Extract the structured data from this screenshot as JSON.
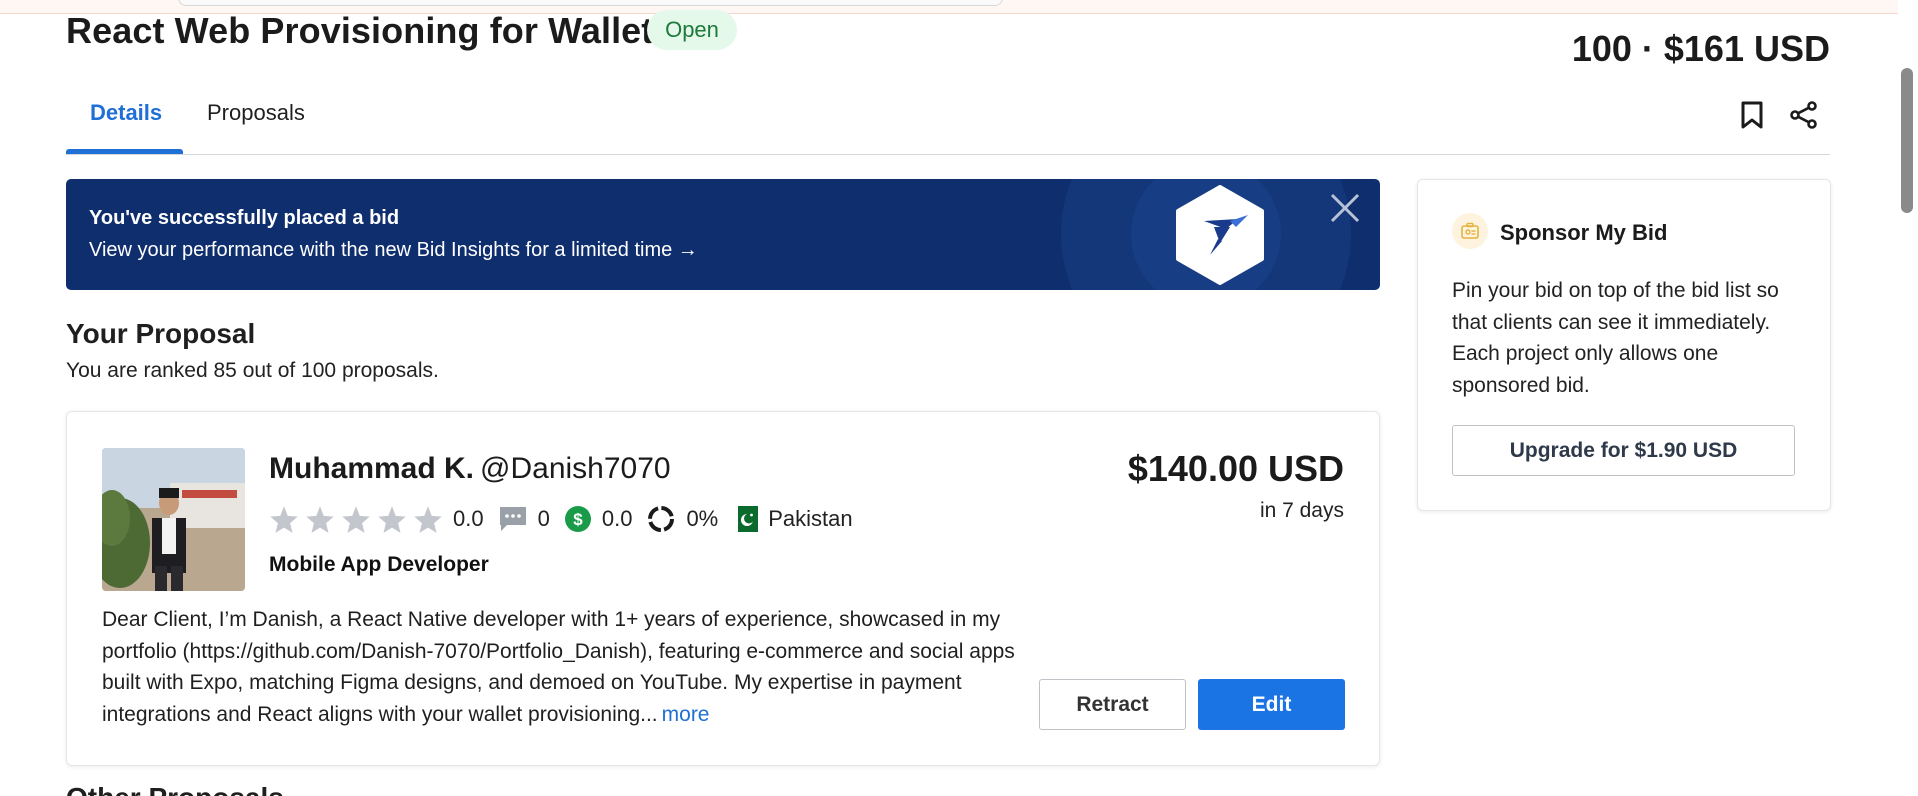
{
  "project": {
    "title": "React Web Provisioning for Wallets",
    "status": "Open",
    "bid_count": "100",
    "separator": "·",
    "avg_bid": "$161 USD"
  },
  "tabs": [
    {
      "label": "Details",
      "active": true
    },
    {
      "label": "Proposals",
      "active": false
    }
  ],
  "banner": {
    "title": "You've successfully placed a bid",
    "message": "View your performance with the new Bid Insights for a limited time →"
  },
  "your_proposal": {
    "heading": "Your Proposal",
    "rank_text": "You are ranked 85 out of 100 proposals."
  },
  "proposal": {
    "name": "Muhammad K.",
    "handle": "@Danish7070",
    "rating": "0.0",
    "reviews": "0",
    "earnings_score": "0.0",
    "completion": "0%",
    "country": "Pakistan",
    "role": "Mobile App Developer",
    "amount": "$140.00 USD",
    "delivery": "in 7 days",
    "text": "Dear Client, I’m Danish, a React Native developer with 1+ years of experience, showcased in my portfolio (https://github.com/Danish-7070/Portfolio_Danish), featuring e-commerce and social apps built with Expo, matching Figma designs, and demoed on YouTube. My expertise in payment integrations and React aligns with your wallet provisioning...",
    "more_label": "more",
    "retract_label": "Retract",
    "edit_label": "Edit"
  },
  "other_proposals_heading": "Other Proposals",
  "sponsor": {
    "title": "Sponsor My Bid",
    "description": "Pin your bid on top of the bid list so that clients can see it immediately. Each project only allows one sponsored bid.",
    "button_label": "Upgrade for $1.90 USD"
  },
  "colors": {
    "accent": "#1b74e4",
    "banner_bg": "#0f2e6e",
    "open_badge_bg": "#e5f9eb",
    "open_badge_text": "#1c7a3b",
    "earnings_green": "#1a9b4a",
    "star_gray": "#c3c7cd"
  },
  "icons": [
    "bookmark-icon",
    "share-icon",
    "close-icon",
    "freelancer-logo-icon",
    "star-icon",
    "chat-icon",
    "dollar-icon",
    "completion-ring-icon",
    "pakistan-flag-icon",
    "sponsor-badge-icon"
  ]
}
